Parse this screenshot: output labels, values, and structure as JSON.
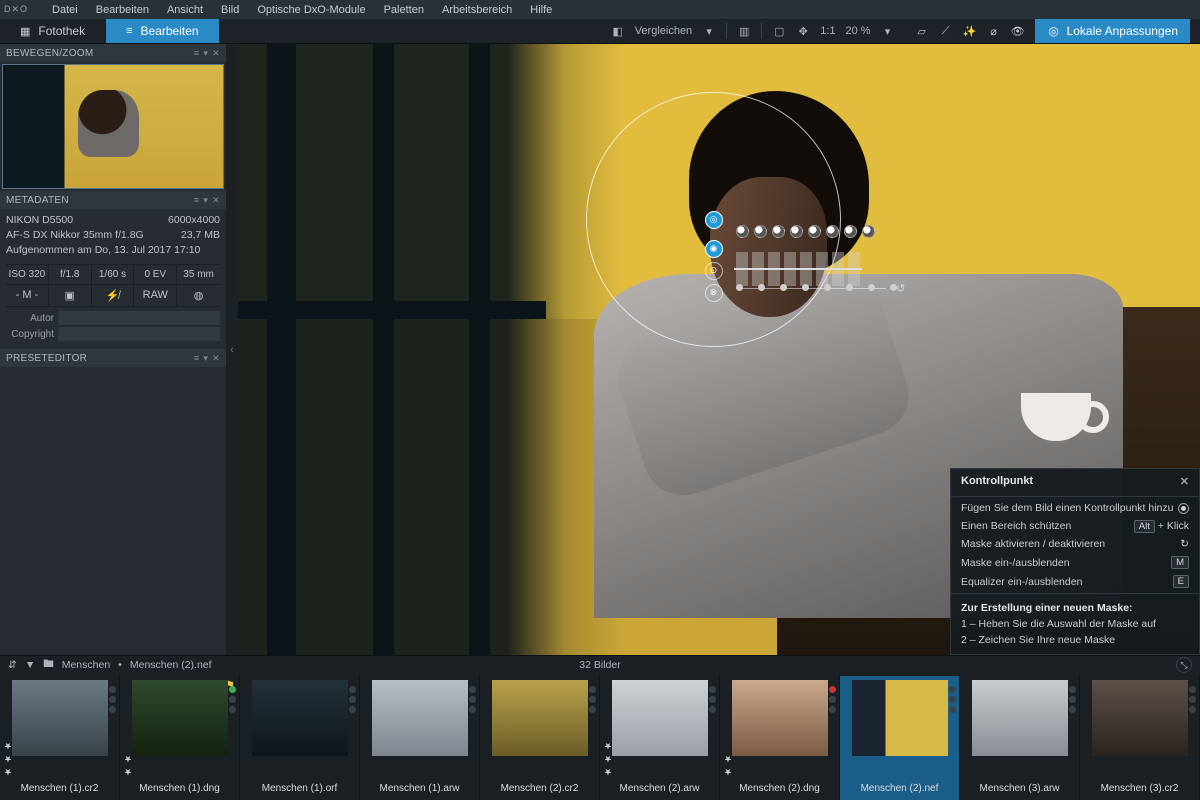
{
  "menu": {
    "items": [
      "Datei",
      "Bearbeiten",
      "Ansicht",
      "Bild",
      "Optische DxO-Module",
      "Paletten",
      "Arbeitsbereich",
      "Hilfe"
    ]
  },
  "modes": {
    "library": "Fotothek",
    "edit": "Bearbeiten"
  },
  "toolbar": {
    "compare": "Vergleichen",
    "ratio": "1:1",
    "zoom": "20 %",
    "local": "Lokale Anpassungen"
  },
  "panels": {
    "nav": "BEWEGEN/ZOOM",
    "meta": "METADATEN",
    "preset": "PRESETEDITOR"
  },
  "metadata": {
    "camera": "NIKON D5500",
    "dims": "6000x4000",
    "lens": "AF-S DX Nikkor 35mm f/1.8G",
    "size": "23,7 MB",
    "taken": "Aufgenommen am Do, 13. Jul 2017 17:10",
    "grid": {
      "iso": "ISO 320",
      "ap": "f/1.8",
      "sh": "1/60 s",
      "ev": "0 EV",
      "fl": "35 mm",
      "mode": "- M -",
      "meter": "▣",
      "flash": "⚡̸",
      "fmt": "RAW",
      "wb": "◍"
    },
    "fields": {
      "author_label": "Autor",
      "copyright_label": "Copyright"
    }
  },
  "popup": {
    "title": "Kontrollpunkt",
    "add": "Fügen Sie dem Bild einen Kontrollpunkt hinzu",
    "protect": "Einen Bereich schützen",
    "protect_key": "Alt",
    "protect_suffix": "+ Klick",
    "toggle_mask": "Maske aktivieren / deaktivieren",
    "show_mask": "Maske ein-/ausblenden",
    "show_mask_key": "M",
    "show_eq": "Equalizer ein-/ausblenden",
    "show_eq_key": "E",
    "new_mask_h": "Zur Erstellung einer neuen Maske:",
    "step1": "1 – Heben Sie die Auswahl der Maske auf",
    "step2": "2 – Zeichen Sie Ihre neue Maske"
  },
  "browser": {
    "folder": "Menschen",
    "file": "Menschen (2).nef",
    "count": "32 Bilder",
    "items": [
      {
        "name": "Menschen (1).cr2"
      },
      {
        "name": "Menschen (1).dng"
      },
      {
        "name": "Menschen (1).orf"
      },
      {
        "name": "Menschen (1).arw"
      },
      {
        "name": "Menschen (2).cr2"
      },
      {
        "name": "Menschen (2).arw"
      },
      {
        "name": "Menschen (2).dng"
      },
      {
        "name": "Menschen (2).nef"
      },
      {
        "name": "Menschen (3).arw"
      },
      {
        "name": "Menschen (3).cr2"
      }
    ]
  }
}
